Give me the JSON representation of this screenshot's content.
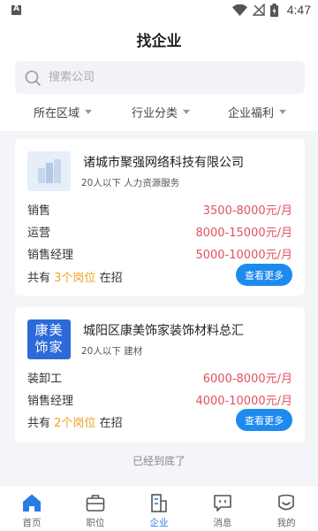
{
  "status_bar": {
    "time": "4:47"
  },
  "header": {
    "title": "找企业"
  },
  "search": {
    "placeholder": "搜索公司"
  },
  "filters": [
    {
      "label": "所在区域"
    },
    {
      "label": "行业分类"
    },
    {
      "label": "企业福利"
    }
  ],
  "companies": [
    {
      "name": "诸城市聚强网络科技有限公司",
      "meta": "20人以下  人力资源服务",
      "logo_text": "",
      "jobs": [
        {
          "title": "销售",
          "salary": "3500-8000元/月"
        },
        {
          "title": "运营",
          "salary": "8000-15000元/月"
        },
        {
          "title": "销售经理",
          "salary": "5000-10000元/月"
        }
      ],
      "summary_prefix": "共有",
      "summary_count": "3个岗位",
      "summary_suffix": "在招",
      "more_label": "查看更多"
    },
    {
      "name": "城阳区康美饰家装饰材料总汇",
      "meta": "20人以下  建材",
      "logo_text_line1": "康美",
      "logo_text_line2": "饰家",
      "jobs": [
        {
          "title": "装卸工",
          "salary": "6000-8000元/月"
        },
        {
          "title": "销售经理",
          "salary": "4000-10000元/月"
        }
      ],
      "summary_prefix": "共有",
      "summary_count": "2个岗位",
      "summary_suffix": "在招",
      "more_label": "查看更多"
    }
  ],
  "end_text": "已经到底了",
  "tabbar": [
    {
      "label": "首页",
      "icon": "home-icon"
    },
    {
      "label": "职位",
      "icon": "briefcase-icon"
    },
    {
      "label": "企业",
      "icon": "company-icon",
      "active": true
    },
    {
      "label": "消息",
      "icon": "message-icon"
    },
    {
      "label": "我的",
      "icon": "profile-icon"
    }
  ],
  "colors": {
    "accent": "#1e8af0",
    "salary": "#e05260",
    "count": "#f0a020",
    "tab_active": "#2b7ce6"
  }
}
